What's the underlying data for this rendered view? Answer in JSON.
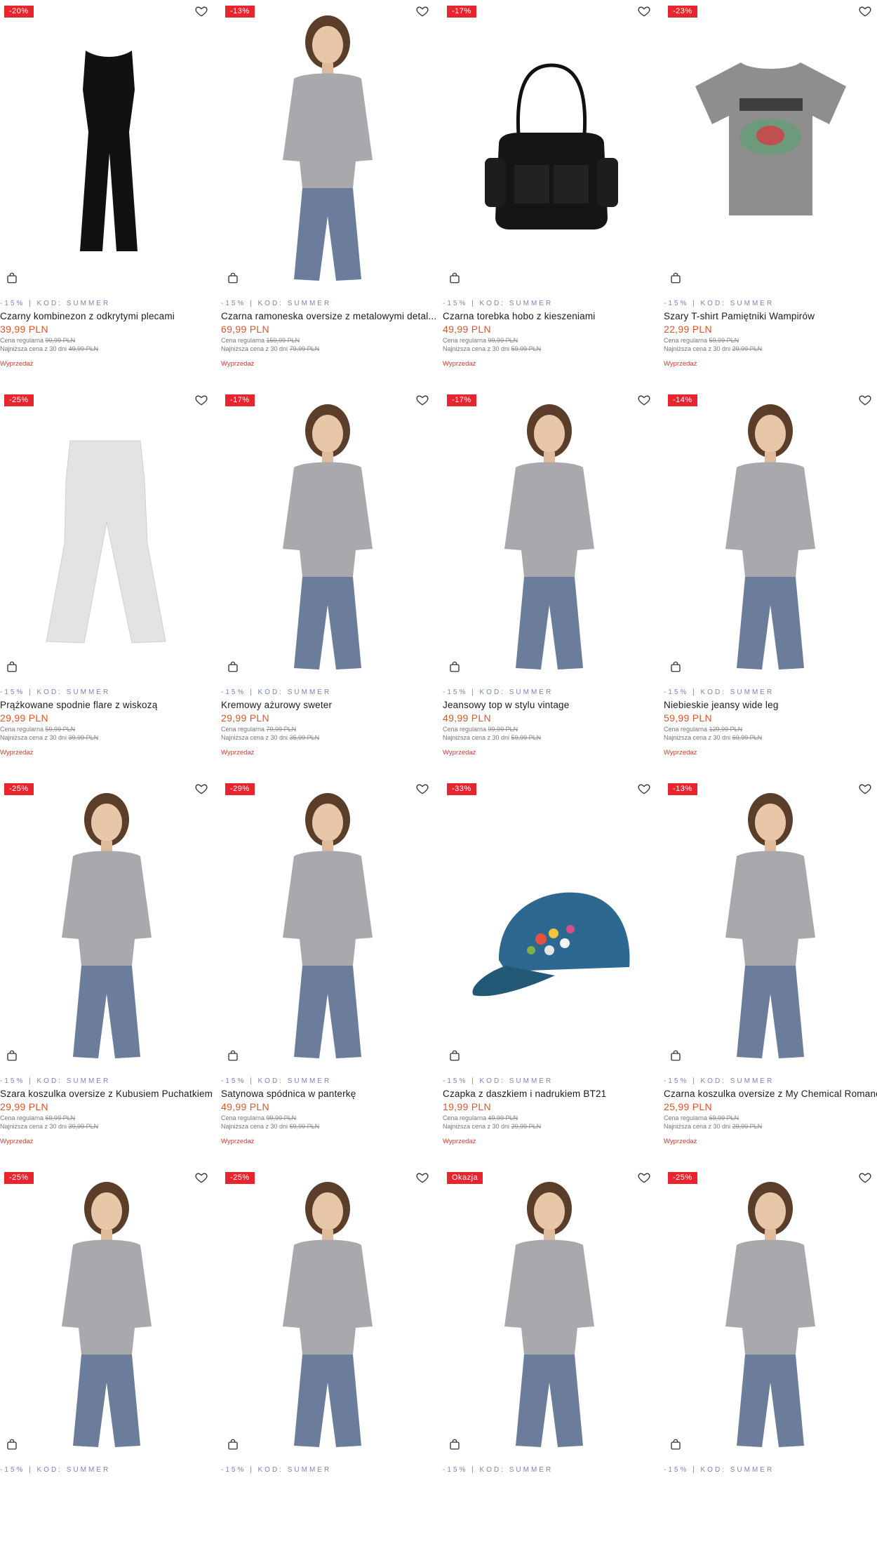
{
  "colors": {
    "badge": "#e8242f",
    "price": "#d9562c",
    "promo": "#7b84b8",
    "sale": "#d23a30"
  },
  "products": [
    {
      "badge": "-20%",
      "promo": "-15% | KOD: SUMMER",
      "name": "Czarny kombinezon z odkrytymi plecami",
      "price": "39,99 PLN",
      "regular_label": "Cena regularna",
      "regular": "99,99 PLN",
      "lowest_label": "Najniższa cena z 30 dni",
      "lowest": "49,99 PLN",
      "tag": "Wyprzedaż",
      "img": "jumpsuit"
    },
    {
      "badge": "-13%",
      "promo": "-15% | KOD: SUMMER",
      "name": "Czarna ramoneska oversize z metalowymi detal...",
      "price": "69,99 PLN",
      "regular_label": "Cena regularna",
      "regular": "159,99 PLN",
      "lowest_label": "Najniższa cena z 30 dni",
      "lowest": "79,99 PLN",
      "tag": "Wyprzedaż",
      "img": "model"
    },
    {
      "badge": "-17%",
      "promo": "-15% | KOD: SUMMER",
      "name": "Czarna torebka hobo z kieszeniami",
      "price": "49,99 PLN",
      "regular_label": "Cena regularna",
      "regular": "99,99 PLN",
      "lowest_label": "Najniższa cena z 30 dni",
      "lowest": "59,99 PLN",
      "tag": "Wyprzedaż",
      "img": "bag"
    },
    {
      "badge": "-23%",
      "promo": "-15% | KOD: SUMMER",
      "name": "Szary T-shirt Pamiętniki Wampirów",
      "price": "22,99 PLN",
      "regular_label": "Cena regularna",
      "regular": "59,99 PLN",
      "lowest_label": "Najniższa cena z 30 dni",
      "lowest": "29,99 PLN",
      "tag": "Wyprzedaż",
      "img": "tshirt"
    },
    {
      "badge": "-25%",
      "promo": "-15% | KOD: SUMMER",
      "name": "Prążkowane spodnie flare z wiskozą",
      "price": "29,99 PLN",
      "regular_label": "Cena regularna",
      "regular": "59,99 PLN",
      "lowest_label": "Najniższa cena z 30 dni",
      "lowest": "39,99 PLN",
      "tag": "Wyprzedaż",
      "img": "pants"
    },
    {
      "badge": "-17%",
      "promo": "-15% | KOD: SUMMER",
      "name": "Kremowy ażurowy sweter",
      "price": "29,99 PLN",
      "regular_label": "Cena regularna",
      "regular": "79,99 PLN",
      "lowest_label": "Najniższa cena z 30 dni",
      "lowest": "35,99 PLN",
      "tag": "Wyprzedaż",
      "img": "model"
    },
    {
      "badge": "-17%",
      "promo": "-15% | KOD: SUMMER",
      "name": "Jeansowy top w stylu vintage",
      "price": "49,99 PLN",
      "regular_label": "Cena regularna",
      "regular": "99,99 PLN",
      "lowest_label": "Najniższa cena z 30 dni",
      "lowest": "59,99 PLN",
      "tag": "Wyprzedaż",
      "img": "model"
    },
    {
      "badge": "-14%",
      "promo": "-15% | KOD: SUMMER",
      "name": "Niebieskie jeansy wide leg",
      "price": "59,99 PLN",
      "regular_label": "Cena regularna",
      "regular": "129,99 PLN",
      "lowest_label": "Najniższa cena z 30 dni",
      "lowest": "69,99 PLN",
      "tag": "Wyprzedaż",
      "img": "model"
    },
    {
      "badge": "-25%",
      "promo": "-15% | KOD: SUMMER",
      "name": "Szara koszulka oversize z Kubusiem Puchatkiem",
      "price": "29,99 PLN",
      "regular_label": "Cena regularna",
      "regular": "69,99 PLN",
      "lowest_label": "Najniższa cena z 30 dni",
      "lowest": "39,99 PLN",
      "tag": "Wyprzedaż",
      "img": "model"
    },
    {
      "badge": "-29%",
      "promo": "-15% | KOD: SUMMER",
      "name": "Satynowa spódnica w panterkę",
      "price": "49,99 PLN",
      "regular_label": "Cena regularna",
      "regular": "99,99 PLN",
      "lowest_label": "Najniższa cena z 30 dni",
      "lowest": "69,99 PLN",
      "tag": "Wyprzedaż",
      "img": "model"
    },
    {
      "badge": "-33%",
      "promo": "-15% | KOD: SUMMER",
      "name": "Czapka z daszkiem i nadrukiem BT21",
      "price": "19,99 PLN",
      "regular_label": "Cena regularna",
      "regular": "49,99 PLN",
      "lowest_label": "Najniższa cena z 30 dni",
      "lowest": "29,99 PLN",
      "tag": "Wyprzedaż",
      "img": "cap"
    },
    {
      "badge": "-13%",
      "promo": "-15% | KOD: SUMMER",
      "name": "Czarna koszulka oversize z My Chemical Romance",
      "price": "25,99 PLN",
      "regular_label": "Cena regularna",
      "regular": "69,99 PLN",
      "lowest_label": "Najniższa cena z 30 dni",
      "lowest": "29,99 PLN",
      "tag": "Wyprzedaż",
      "img": "model"
    },
    {
      "badge": "-25%",
      "promo": "-15% | KOD: SUMMER",
      "img": "model"
    },
    {
      "badge": "-25%",
      "promo": "-15% | KOD: SUMMER",
      "img": "model"
    },
    {
      "badge": "Okazja",
      "promo": "-15% | KOD: SUMMER",
      "img": "model"
    },
    {
      "badge": "-25%",
      "promo": "-15% | KOD: SUMMER",
      "img": "model"
    }
  ]
}
